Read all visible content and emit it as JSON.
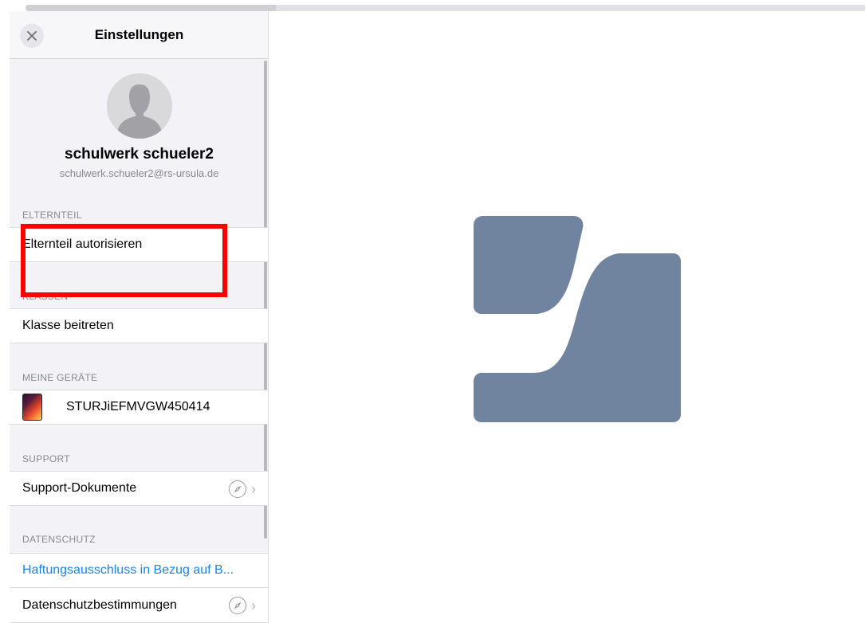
{
  "header": {
    "title": "Einstellungen"
  },
  "profile": {
    "name": "schulwerk schueler2",
    "email": "schulwerk.schueler2@rs-ursula.de"
  },
  "sections": {
    "parent": {
      "label": "ELTERNTEIL",
      "row": "Elternteil autorisieren"
    },
    "classes": {
      "label": "KLASSEN",
      "row": "Klasse beitreten"
    },
    "devices": {
      "label": "MEINE GERÄTE",
      "row": "STURJiEFMVGW450414"
    },
    "support": {
      "label": "SUPPORT",
      "row": "Support-Dokumente"
    },
    "privacy": {
      "label": "DATENSCHUTZ",
      "disclaimer": "Haftungsausschluss in Bezug auf B...",
      "policy": "Datenschutzbestimmungen"
    }
  },
  "icons": {
    "close": "close-icon",
    "avatar": "person-silhouette-icon",
    "device": "ipad-icon",
    "compass": "compass-icon",
    "chevron": "chevron-right-icon",
    "logo": "app-logo"
  },
  "colors": {
    "accent_link": "#1a84e6",
    "highlight": "#ff0000",
    "logo": "#71849f"
  }
}
